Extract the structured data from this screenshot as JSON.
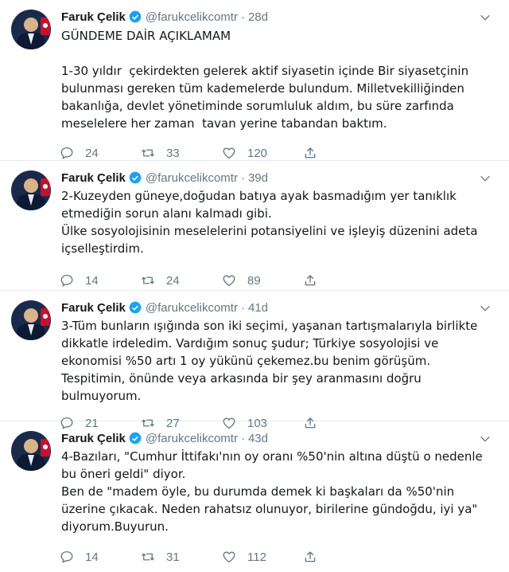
{
  "tweets": [
    {
      "name": "Faruk Çelik",
      "handle": "@farukcelikcomtr",
      "dot": "·",
      "age": "28d",
      "text": "GÜNDEME DAİR AÇIKLAMAM\n\n1-30 yıldır  çekirdekten gelerek aktif siyasetin içinde Bir siyasetçinin bulunması gereken tüm kademelerde bulundum. Milletvekilliğinden bakanlığa, devlet yönetiminde sorumluluk aldım, bu süre zarfında meselelere her zaman  tavan yerine tabandan baktım.",
      "replies": "24",
      "retweets": "33",
      "likes": "120"
    },
    {
      "name": "Faruk Çelik",
      "handle": "@farukcelikcomtr",
      "dot": "·",
      "age": "39d",
      "text": "2-Kuzeyden güneye,doğudan batıya ayak basmadığım yer tanıklık etmediğin sorun alanı kalmadı gibi.\nÜlke sosyolojisinin meselelerini potansiyelini ve işleyiş düzenini adeta içselleştirdim.",
      "replies": "14",
      "retweets": "24",
      "likes": "89"
    },
    {
      "name": "Faruk Çelik",
      "handle": "@farukcelikcomtr",
      "dot": "·",
      "age": "41d",
      "text": "3-Tüm bunların ışığında son iki seçimi, yaşanan tartışmalarıyla birlikte dikkatle irdeledim. Vardığım sonuç şudur; Türkiye sosyolojisi ve ekonomisi %50 artı 1 oy yükünü çekemez.bu benim görüşüm.\nTespitimin, önünde veya arkasında bir şey aranmasını doğru bulmuyorum.",
      "replies": "21",
      "retweets": "27",
      "likes": "103"
    },
    {
      "name": "Faruk Çelik",
      "handle": "@farukcelikcomtr",
      "dot": "·",
      "age": "43d",
      "text": "4-Bazıları, \"Cumhur İttifakı'nın oy oranı %50'nin altına düştü o nedenle bu öneri geldi\" diyor.\nBen de \"madem öyle, bu durumda demek ki başkaları da %50'nin üzerine çıkacak. Neden rahatsız olunuyor, birilerine gündoğdu, iyi ya\"\ndiyorum.Buyurun.",
      "replies": "14",
      "retweets": "31",
      "likes": "112"
    }
  ],
  "icons": {
    "verified": "verified-badge-icon",
    "caret": "chevron-down-icon",
    "reply": "reply-icon",
    "retweet": "retweet-icon",
    "like": "heart-icon",
    "share": "share-icon"
  },
  "colors": {
    "verified": "#1da1f2",
    "muted": "#657786",
    "text": "#14171a",
    "divider": "#e6ecf0"
  }
}
